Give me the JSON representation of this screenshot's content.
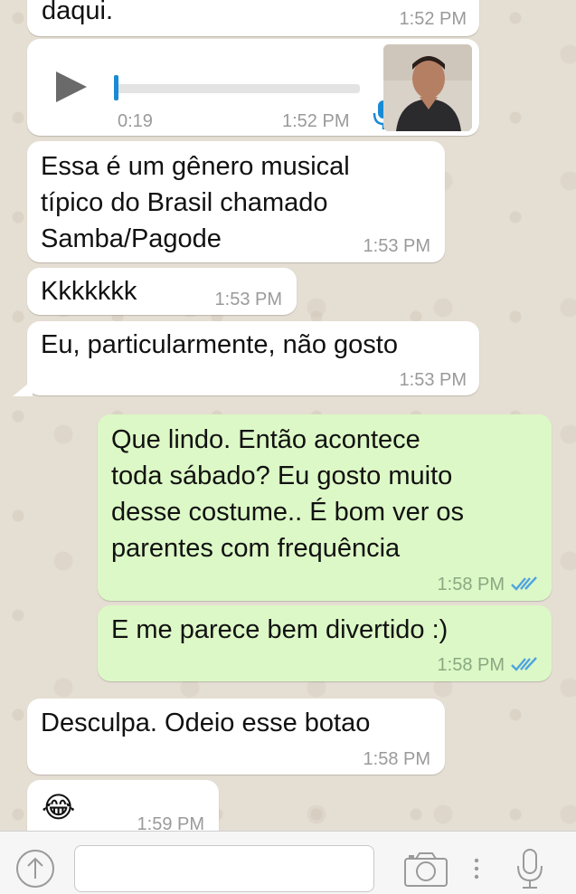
{
  "messages": [
    {
      "id": "m0",
      "direction": "in",
      "text": "daqui.",
      "time": "1:52 PM"
    },
    {
      "id": "m1",
      "direction": "in",
      "type": "audio",
      "duration": "0:19",
      "time": "1:52 PM",
      "progress": 0.0
    },
    {
      "id": "m2",
      "direction": "in",
      "text": "Essa é um gênero musical\ntípico do Brasil chamado\nSamba/Pagode",
      "time": "1:53 PM"
    },
    {
      "id": "m3",
      "direction": "in",
      "text": "Kkkkkkk",
      "time": "1:53 PM"
    },
    {
      "id": "m4",
      "direction": "in",
      "text": "Eu, particularmente, não gosto",
      "time": "1:53 PM"
    },
    {
      "id": "m5",
      "direction": "out",
      "text": "Que lindo. Então acontece\ntoda sábado? Eu gosto muito\ndesse costume.. É bom ver os\nparentes com frequência",
      "time": "1:58 PM",
      "status": "read"
    },
    {
      "id": "m6",
      "direction": "out",
      "text": "E me parece bem divertido :)",
      "time": "1:58 PM",
      "status": "read"
    },
    {
      "id": "m7",
      "direction": "in",
      "text": "Desculpa. Odeio esse botao",
      "time": "1:58 PM"
    },
    {
      "id": "m8",
      "direction": "in",
      "text": "😂",
      "time": "1:59 PM"
    }
  ],
  "input_bar": {
    "placeholder": "",
    "value": ""
  },
  "colors": {
    "incoming_bubble": "#ffffff",
    "outgoing_bubble": "#dcf8c6",
    "read_ticks": "#4fa3e0",
    "audio_accent": "#1a8ad4"
  }
}
